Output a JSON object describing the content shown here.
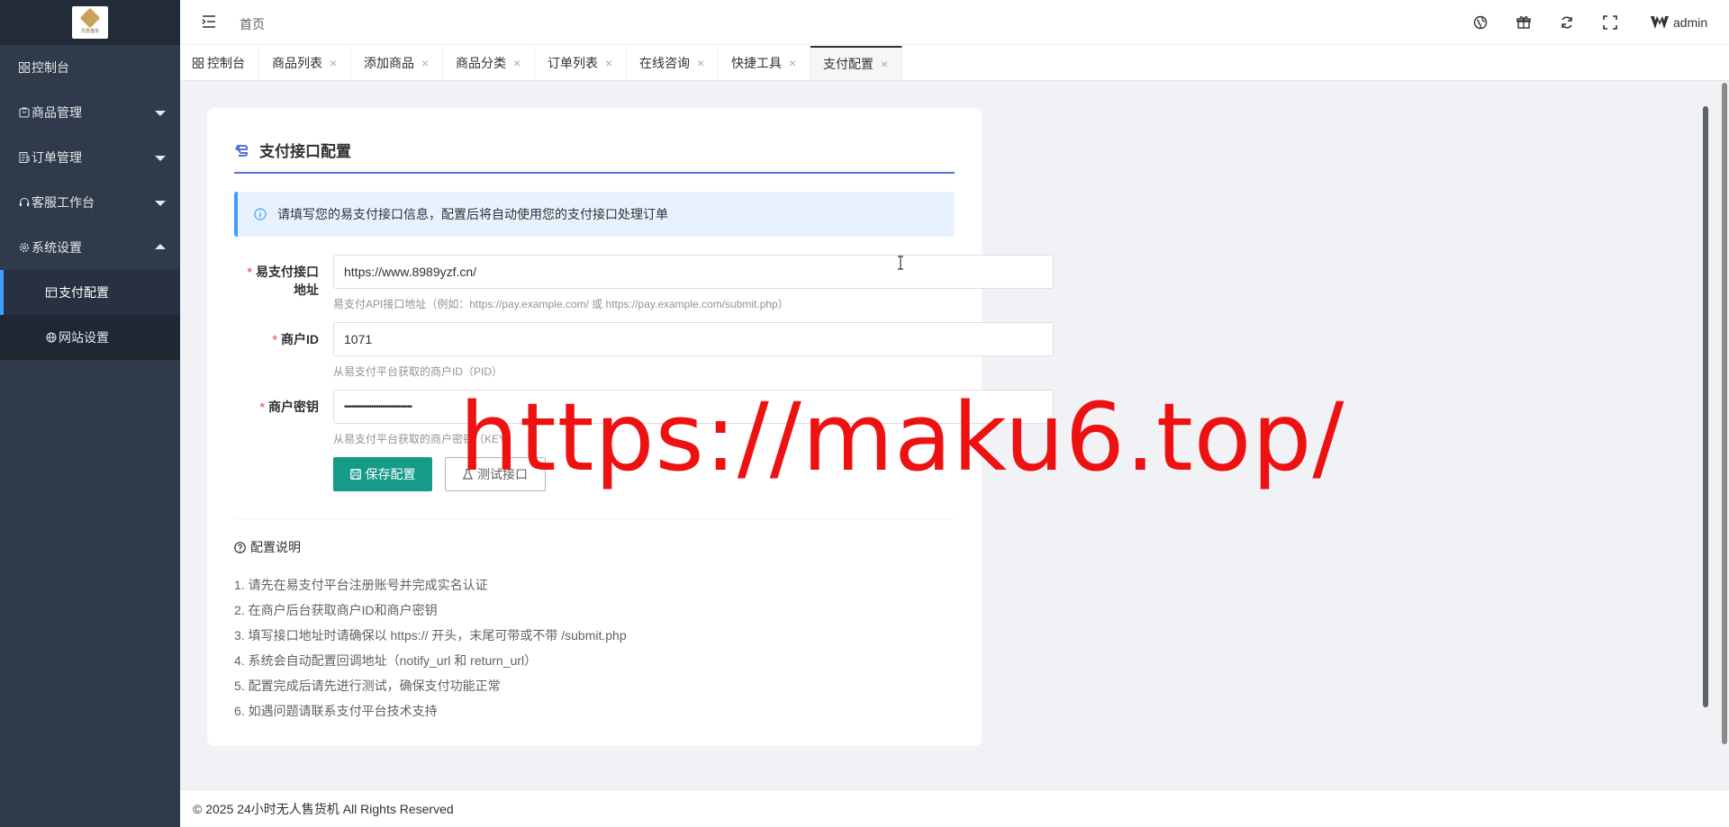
{
  "app": {
    "logo_text": "优惠猫享"
  },
  "sidebar": {
    "items": [
      {
        "label": "控制台",
        "icon": "dashboard-icon"
      },
      {
        "label": "商品管理",
        "icon": "goods-icon"
      },
      {
        "label": "订单管理",
        "icon": "order-icon"
      },
      {
        "label": "客服工作台",
        "icon": "headset-icon"
      },
      {
        "label": "系统设置",
        "icon": "gear-icon"
      }
    ],
    "sub_items": [
      {
        "label": "支付配置",
        "icon": "payment-icon",
        "active": true
      },
      {
        "label": "网站设置",
        "icon": "globe-icon"
      }
    ]
  },
  "header": {
    "breadcrumb": "首页",
    "user": "admin",
    "icons": [
      "language-icon",
      "gift-icon",
      "refresh-icon",
      "fullscreen-icon"
    ]
  },
  "tabs": [
    {
      "label": "控制台",
      "closable": false
    },
    {
      "label": "商品列表",
      "closable": true
    },
    {
      "label": "添加商品",
      "closable": true
    },
    {
      "label": "商品分类",
      "closable": true
    },
    {
      "label": "订单列表",
      "closable": true
    },
    {
      "label": "在线咨询",
      "closable": true
    },
    {
      "label": "快捷工具",
      "closable": true
    },
    {
      "label": "支付配置",
      "closable": true,
      "active": true
    }
  ],
  "tab_close_glyph": "×",
  "card": {
    "title": "支付接口配置",
    "alert": "请填写您的易支付接口信息，配置后将自动使用您的支付接口处理订单",
    "form": {
      "required_mark": "*",
      "api_url": {
        "label_line1": "易支付接口",
        "label_line2": "地址",
        "value": "https://www.8989yzf.cn/",
        "hint": "易支付API接口地址（例如：https://pay.example.com/ 或 https://pay.example.com/submit.php）"
      },
      "merchant_id": {
        "label": "商户ID",
        "value": "1071",
        "hint": "从易支付平台获取的商户ID（PID）"
      },
      "merchant_key": {
        "label": "商户密钥",
        "value": "••••••••••••••••••••••••••••••",
        "hint": "从易支付平台获取的商户密钥（KEY）"
      }
    },
    "buttons": {
      "save": "保存配置",
      "test": "测试接口"
    },
    "notes_title": "配置说明",
    "notes": [
      "1. 请先在易支付平台注册账号并完成实名认证",
      "2. 在商户后台获取商户ID和商户密钥",
      "3. 填写接口地址时请确保以 https:// 开头，末尾可带或不带 /submit.php",
      "4. 系统会自动配置回调地址（notify_url 和 return_url）",
      "5. 配置完成后请先进行测试，确保支付功能正常",
      "6. 如遇问题请联系支付平台技术支持"
    ]
  },
  "watermark": "https://maku6.top/",
  "footer": "© 2025 24小时无人售货机 All Rights Reserved",
  "colors": {
    "sidebar_bg": "#2f3a4a",
    "accent_teal": "#169b89",
    "primary_blue": "#409eff",
    "watermark_red": "#ee1111"
  }
}
